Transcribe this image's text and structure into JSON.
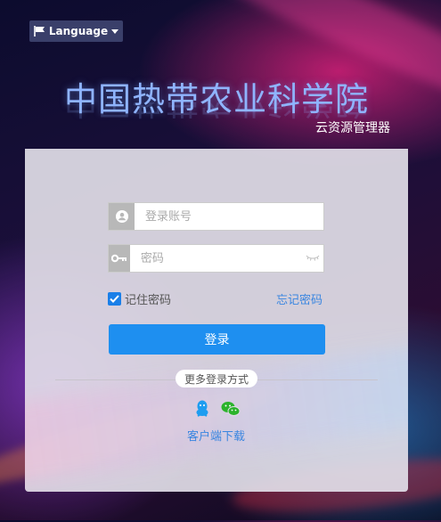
{
  "language_button": {
    "label": "Language",
    "icon": "flag-icon"
  },
  "header": {
    "title": "中国热带农业科学院",
    "subtitle": "云资源管理器"
  },
  "login": {
    "account": {
      "placeholder": "登录账号",
      "value": "",
      "icon": "user-icon"
    },
    "password": {
      "placeholder": "密码",
      "value": "",
      "icon": "key-icon"
    },
    "remember_label": "记住密码",
    "remember_checked": true,
    "forgot_label": "忘记密码",
    "submit_label": "登录",
    "more_methods_label": "更多登录方式",
    "methods": [
      "qq-icon",
      "wechat-icon"
    ],
    "client_download_label": "客户端下载"
  },
  "colors": {
    "primary": "#1e8ff0",
    "link": "#3a86e0",
    "title": "#8fb4ff"
  }
}
